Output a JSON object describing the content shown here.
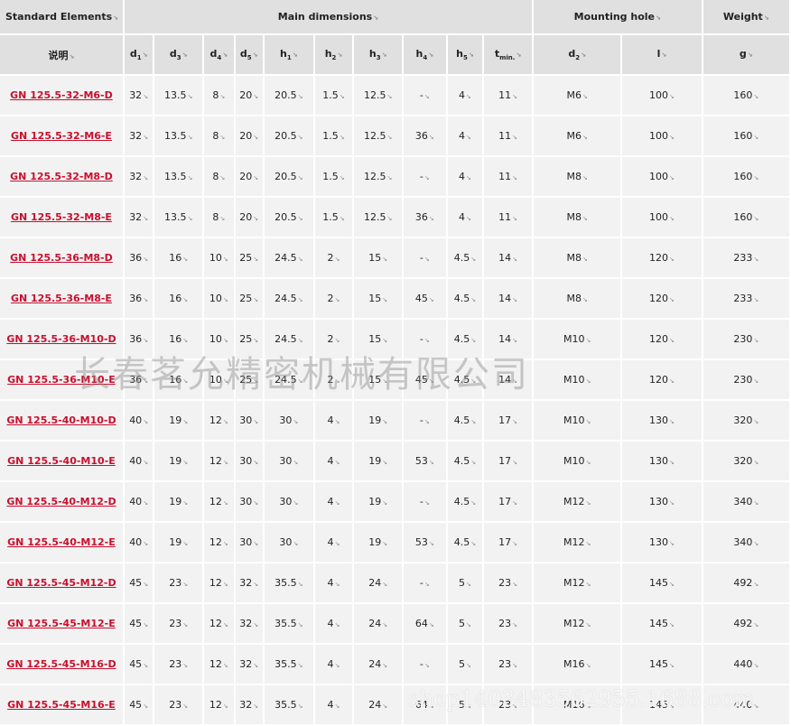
{
  "header": {
    "standard_elements": "Standard Elements",
    "main_dimensions": "Main dimensions",
    "mounting_hole": "Mounting hole",
    "weight": "Weight",
    "desc": "说明"
  },
  "columns": [
    {
      "base": "d",
      "sub": "1"
    },
    {
      "base": "d",
      "sub": "3"
    },
    {
      "base": "d",
      "sub": "4"
    },
    {
      "base": "d",
      "sub": "5"
    },
    {
      "base": "h",
      "sub": "1"
    },
    {
      "base": "h",
      "sub": "2"
    },
    {
      "base": "h",
      "sub": "3"
    },
    {
      "base": "h",
      "sub": "4"
    },
    {
      "base": "h",
      "sub": "5"
    },
    {
      "base": "t",
      "sub": "min."
    },
    {
      "base": "d",
      "sub": "2"
    },
    {
      "base": "l",
      "sub": ""
    },
    {
      "base": "g",
      "sub": ""
    }
  ],
  "rows": [
    {
      "name": "GN 125.5-32-M6-D",
      "values": [
        "32",
        "13.5",
        "8",
        "20",
        "20.5",
        "1.5",
        "12.5",
        "-",
        "4",
        "11",
        "M6",
        "100",
        "160"
      ]
    },
    {
      "name": "GN 125.5-32-M6-E",
      "values": [
        "32",
        "13.5",
        "8",
        "20",
        "20.5",
        "1.5",
        "12.5",
        "36",
        "4",
        "11",
        "M6",
        "100",
        "160"
      ]
    },
    {
      "name": "GN 125.5-32-M8-D",
      "values": [
        "32",
        "13.5",
        "8",
        "20",
        "20.5",
        "1.5",
        "12.5",
        "-",
        "4",
        "11",
        "M8",
        "100",
        "160"
      ]
    },
    {
      "name": "GN 125.5-32-M8-E",
      "values": [
        "32",
        "13.5",
        "8",
        "20",
        "20.5",
        "1.5",
        "12.5",
        "36",
        "4",
        "11",
        "M8",
        "100",
        "160"
      ]
    },
    {
      "name": "GN 125.5-36-M8-D",
      "values": [
        "36",
        "16",
        "10",
        "25",
        "24.5",
        "2",
        "15",
        "-",
        "4.5",
        "14",
        "M8",
        "120",
        "233"
      ]
    },
    {
      "name": "GN 125.5-36-M8-E",
      "values": [
        "36",
        "16",
        "10",
        "25",
        "24.5",
        "2",
        "15",
        "45",
        "4.5",
        "14",
        "M8",
        "120",
        "233"
      ]
    },
    {
      "name": "GN 125.5-36-M10-D",
      "values": [
        "36",
        "16",
        "10",
        "25",
        "24.5",
        "2",
        "15",
        "-",
        "4.5",
        "14",
        "M10",
        "120",
        "230"
      ]
    },
    {
      "name": "GN 125.5-36-M10-E",
      "values": [
        "36",
        "16",
        "10",
        "25",
        "24.5",
        "2",
        "15",
        "45",
        "4.5",
        "14",
        "M10",
        "120",
        "230"
      ]
    },
    {
      "name": "GN 125.5-40-M10-D",
      "values": [
        "40",
        "19",
        "12",
        "30",
        "30",
        "4",
        "19",
        "-",
        "4.5",
        "17",
        "M10",
        "130",
        "320"
      ]
    },
    {
      "name": "GN 125.5-40-M10-E",
      "values": [
        "40",
        "19",
        "12",
        "30",
        "30",
        "4",
        "19",
        "53",
        "4.5",
        "17",
        "M10",
        "130",
        "320"
      ]
    },
    {
      "name": "GN 125.5-40-M12-D",
      "values": [
        "40",
        "19",
        "12",
        "30",
        "30",
        "4",
        "19",
        "-",
        "4.5",
        "17",
        "M12",
        "130",
        "340"
      ]
    },
    {
      "name": "GN 125.5-40-M12-E",
      "values": [
        "40",
        "19",
        "12",
        "30",
        "30",
        "4",
        "19",
        "53",
        "4.5",
        "17",
        "M12",
        "130",
        "340"
      ]
    },
    {
      "name": "GN 125.5-45-M12-D",
      "values": [
        "45",
        "23",
        "12",
        "32",
        "35.5",
        "4",
        "24",
        "-",
        "5",
        "23",
        "M12",
        "145",
        "492"
      ]
    },
    {
      "name": "GN 125.5-45-M12-E",
      "values": [
        "45",
        "23",
        "12",
        "32",
        "35.5",
        "4",
        "24",
        "64",
        "5",
        "23",
        "M12",
        "145",
        "492"
      ]
    },
    {
      "name": "GN 125.5-45-M16-D",
      "values": [
        "45",
        "23",
        "12",
        "32",
        "35.5",
        "4",
        "24",
        "-",
        "5",
        "23",
        "M16",
        "145",
        "440"
      ]
    },
    {
      "name": "GN 125.5-45-M16-E",
      "values": [
        "45",
        "23",
        "12",
        "32",
        "35.5",
        "4",
        "24",
        "64",
        "5",
        "23",
        "M16",
        "145",
        "440"
      ]
    }
  ],
  "watermark": "长春茗允精密机械有限公司",
  "watermark2": "shop1403483562955.1688.com",
  "colors": {
    "link": "#c8102e",
    "header_bg": "#e0e0e0",
    "cell_bg": "#f2f2f2"
  }
}
